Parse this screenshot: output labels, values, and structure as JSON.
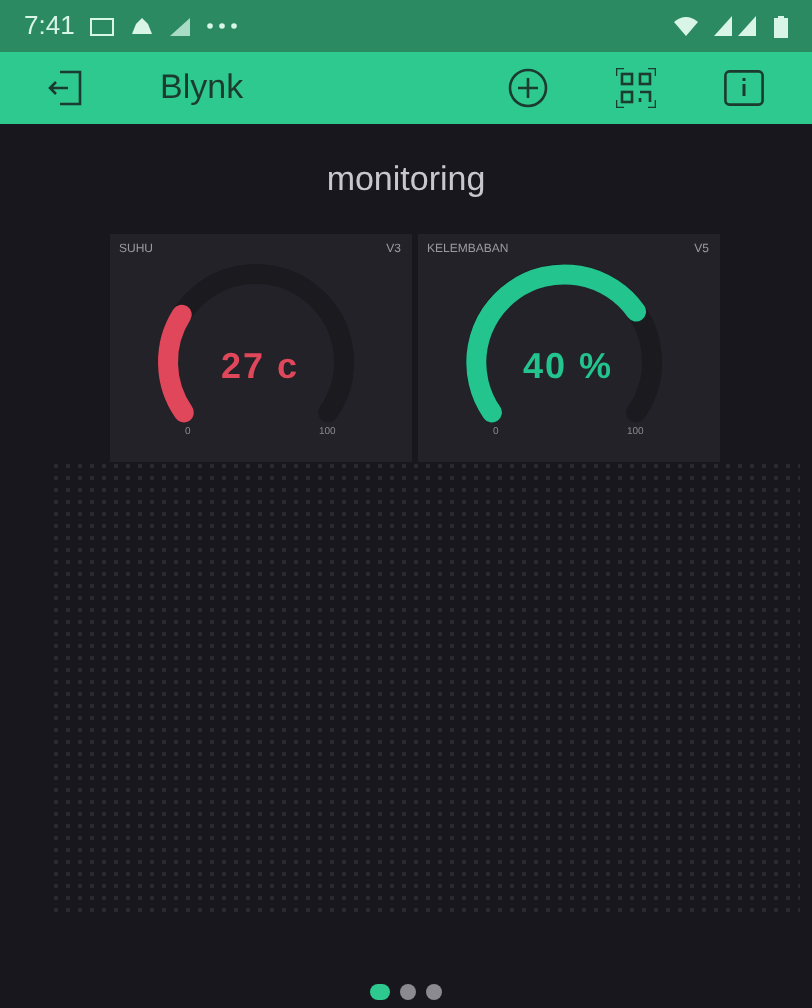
{
  "status_bar": {
    "time": "7:41"
  },
  "app_bar": {
    "title": "Blynk"
  },
  "project": {
    "title": "monitoring"
  },
  "gauges": [
    {
      "label": "SUHU",
      "pin": "V3",
      "value": "27 c",
      "color": "#e0475a",
      "min": "0",
      "max": "100"
    },
    {
      "label": "KELEMBABAN",
      "pin": "V5",
      "value": "40 %",
      "color": "#23c48e",
      "min": "0",
      "max": "100"
    }
  ],
  "pages": [
    {
      "selected": true
    },
    {
      "selected": false
    },
    {
      "selected": false
    }
  ]
}
